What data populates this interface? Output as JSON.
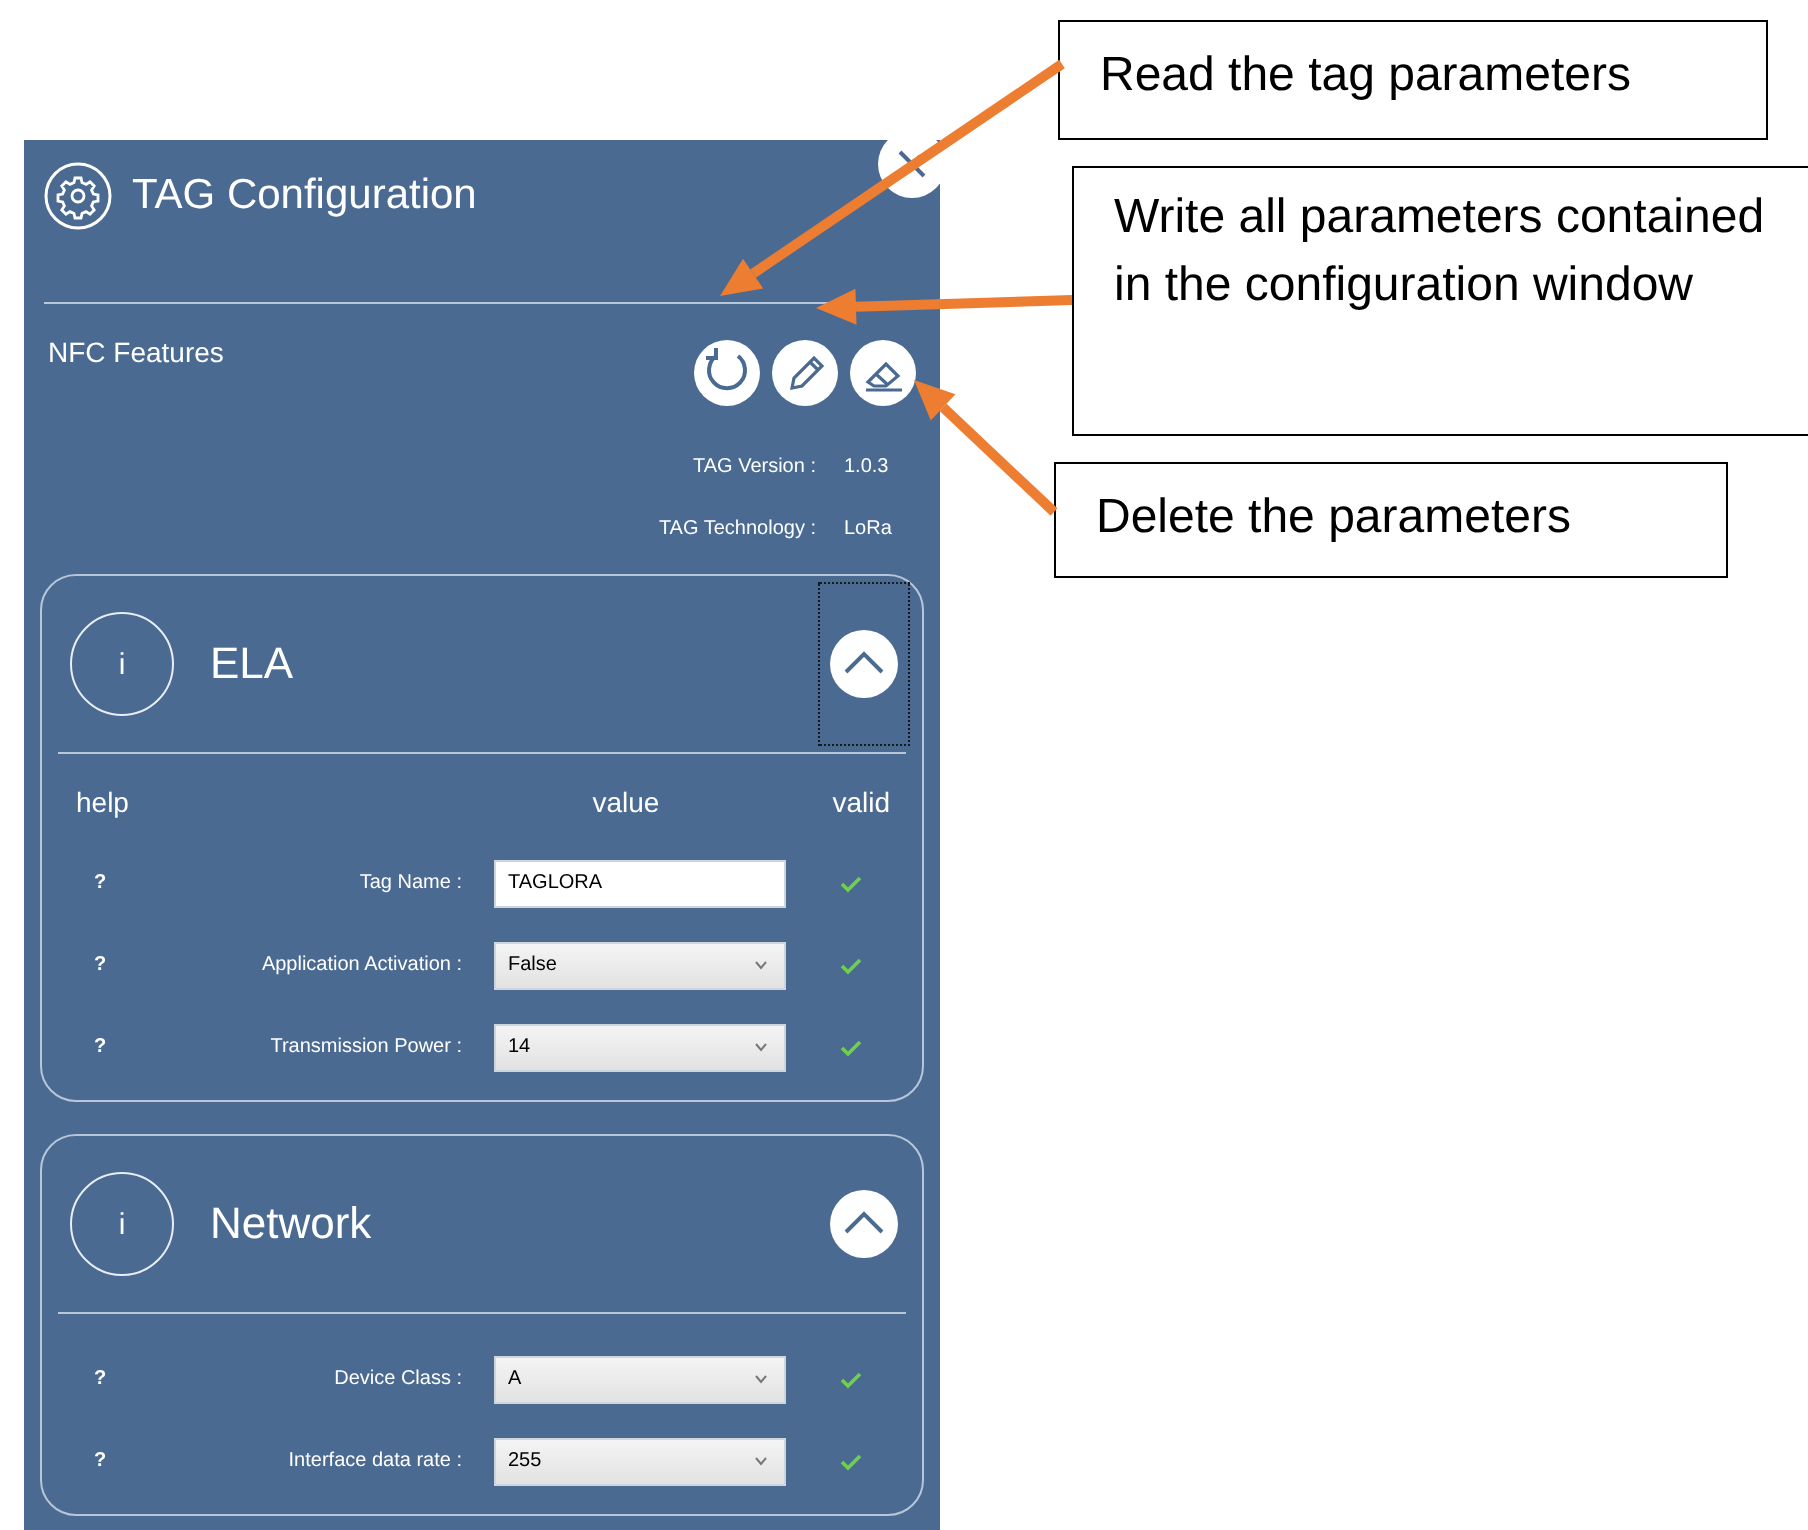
{
  "panel": {
    "title": "TAG Configuration",
    "subtitle": "NFC Features",
    "info": [
      {
        "label": "TAG Version :",
        "value": "1.0.3"
      },
      {
        "label": "TAG Technology :",
        "value": "LoRa"
      }
    ]
  },
  "sections": [
    {
      "title": "ELA",
      "icon": "i",
      "focused": true,
      "columns": [
        "help",
        "value",
        "valid"
      ],
      "fields": [
        {
          "help": "?",
          "label": "Tag Name :",
          "kind": "text",
          "value": "TAGLORA",
          "valid": true
        },
        {
          "help": "?",
          "label": "Application Activation :",
          "kind": "select",
          "value": "False",
          "valid": true
        },
        {
          "help": "?",
          "label": "Transmission Power :",
          "kind": "select",
          "value": "14",
          "valid": true
        }
      ]
    },
    {
      "title": "Network",
      "icon": "i",
      "focused": false,
      "fields": [
        {
          "help": "?",
          "label": "Device Class :",
          "kind": "select",
          "value": "A",
          "valid": true
        },
        {
          "help": "?",
          "label": "Interface data rate :",
          "kind": "select",
          "value": "255",
          "valid": true
        }
      ]
    }
  ],
  "callouts": [
    {
      "text": "Read the tag parameters"
    },
    {
      "text": "Write all parameters contained in the configuration window"
    },
    {
      "text": "Delete the parameters"
    }
  ]
}
